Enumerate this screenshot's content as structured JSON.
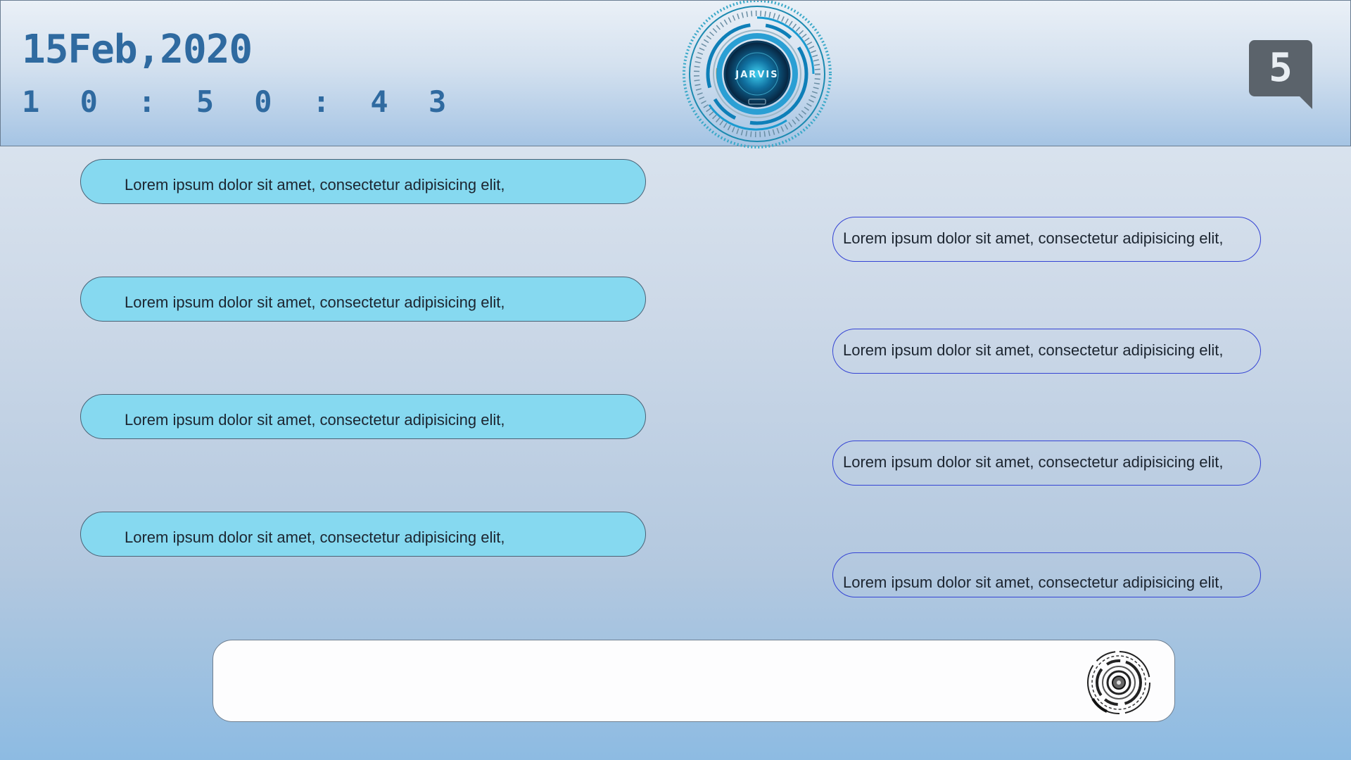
{
  "header": {
    "date": "15Feb,2020",
    "time": "1 0 : 5 0 : 4 3",
    "logo_text": "JARVIS",
    "badge_number": "5"
  },
  "chat": {
    "user_messages": [
      "Lorem ipsum dolor sit amet, consectetur adipisicing elit,",
      "Lorem ipsum dolor sit amet, consectetur adipisicing elit,",
      "Lorem ipsum dolor sit amet, consectetur adipisicing elit,",
      "Lorem ipsum dolor sit amet, consectetur adipisicing elit,"
    ],
    "assistant_messages": [
      "Lorem ipsum dolor sit amet, consectetur adipisicing elit,",
      "Lorem ipsum dolor sit amet, consectetur adipisicing elit,",
      "Lorem ipsum dolor sit amet, consectetur adipisicing elit,",
      "Lorem ipsum dolor sit amet, consectetur adipisicing elit,"
    ]
  },
  "input": {
    "value": "",
    "placeholder": "",
    "action_icon": "mic-target-icon"
  },
  "colors": {
    "accent_text": "#2f6aa0",
    "user_bubble": "#86d9f0",
    "assistant_border": "#3443d4",
    "badge": "#5b636b"
  }
}
